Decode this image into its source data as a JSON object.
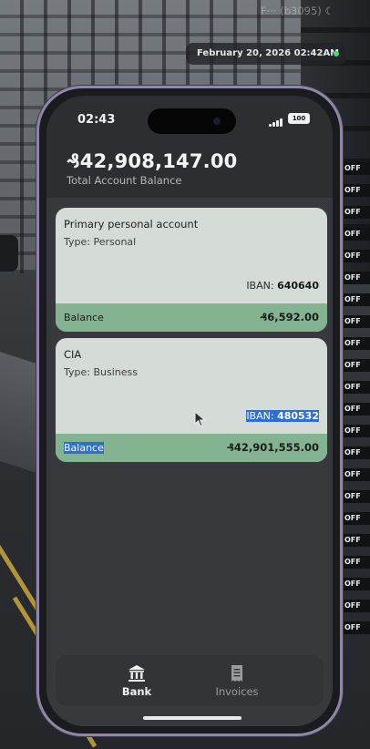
{
  "overlay": {
    "player_id": "F··· (b3095)",
    "datetime": "February 20, 2026 02:42AM",
    "off_tag": "OFF",
    "moon_icon": "moon-icon",
    "status_color": "#3ddc6b"
  },
  "phone": {
    "status_bar": {
      "time": "02:43",
      "battery": "100"
    },
    "summary": {
      "total_balance": "₰42,908,147.00",
      "total_label": "Total Account Balance"
    },
    "accounts": [
      {
        "name": "Primary personal account",
        "type": "Type: Personal",
        "iban_label": "IBAN:",
        "iban": "640640",
        "balance_label": "Balance",
        "balance": "₰6,592.00"
      },
      {
        "name": "CIA",
        "type": "Type: Business",
        "iban_label": "IBAN:",
        "iban": "480532",
        "balance_label": "Balance",
        "balance": "₰42,901,555.00"
      }
    ],
    "tabs": [
      {
        "label": "Bank",
        "icon": "bank-icon",
        "active": true
      },
      {
        "label": "Invoices",
        "icon": "receipt-icon",
        "active": false
      }
    ],
    "colors": {
      "card_bg": "#d5dbd7",
      "balance_bar": "#84b392",
      "selection": "#2f6fd1",
      "frame_accent": "#8f86a8"
    }
  }
}
